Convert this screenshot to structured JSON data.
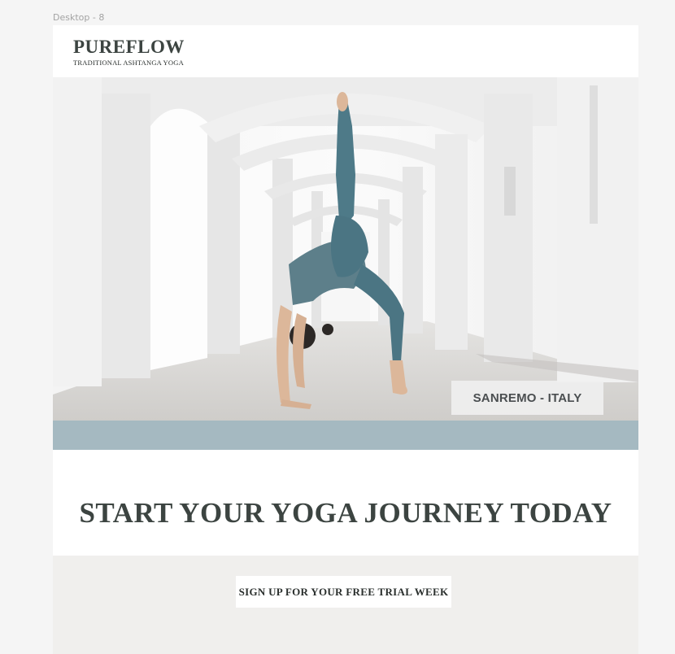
{
  "canvas": {
    "frame_label": "Desktop - 8"
  },
  "header": {
    "brand": "PUREFLOW",
    "tagline": "TRADITIONAL ASHTANGA YOGA"
  },
  "hero": {
    "image_alt": "Woman in yoga pose under white arches",
    "location": "SANREMO - ITALY"
  },
  "cta": {
    "heading": "START YOUR YOGA JOURNEY TODAY",
    "button_label": "SIGN UP FOR YOUR FREE TRIAL WEEK"
  },
  "colors": {
    "background": "#f5f5f5",
    "brand_text": "#3c4441",
    "band": "#a5b9c1",
    "lower_panel": "#f0efed"
  }
}
